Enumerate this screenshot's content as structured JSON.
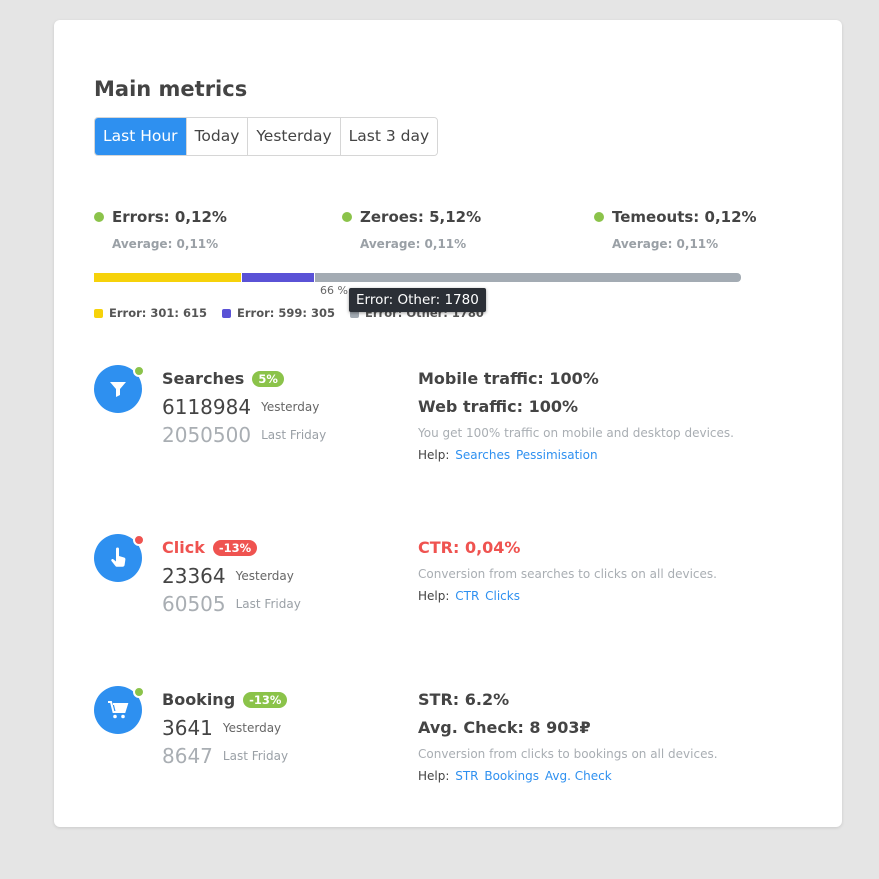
{
  "title": "Main metrics",
  "tabs": [
    "Last Hour",
    "Today",
    "Yesterday",
    "Last 3 day"
  ],
  "active_tab": 0,
  "colors": {
    "accent": "#2e90f0",
    "green": "#8bc34a",
    "red": "#ef5350",
    "yellow": "#f6d20a",
    "purple": "#5a52d6",
    "gray": "#a3abb3"
  },
  "stats": [
    {
      "label": "Errors: 0,12%",
      "avg": "Average: 0,11%"
    },
    {
      "label": "Zeroes: 5,12%",
      "avg": "Average: 0,11%"
    },
    {
      "label": "Temeouts: 0,12%",
      "avg": "Average: 0,11%"
    }
  ],
  "error_bar": {
    "segments": [
      {
        "name": "Error: 301",
        "value": 615,
        "legend": "Error: 301: 615"
      },
      {
        "name": "Error: 599",
        "value": 305,
        "legend": "Error: 599: 305"
      },
      {
        "name": "Error: Other",
        "value": 1780,
        "legend": "Error: Other: 1780"
      }
    ],
    "percent_label": "66 %",
    "tooltip": "Error: Other: 1780"
  },
  "metrics": [
    {
      "name": "Searches",
      "badge": "5%",
      "status": "green",
      "icon": "filter-icon",
      "yesterday_value": "6118984",
      "yesterday_label": "Yesterday",
      "lastweek_value": "2050500",
      "lastweek_label": "Last Friday",
      "lines": [
        "Mobile traffic: 100%",
        "Web traffic: 100%"
      ],
      "desc": "You get 100% traffic on mobile and desktop devices.",
      "help_label": "Help:",
      "help_links": [
        "Searches",
        "Pessimisation"
      ]
    },
    {
      "name": "Click",
      "badge": "-13%",
      "status": "red",
      "icon": "pointer-icon",
      "yesterday_value": "23364",
      "yesterday_label": "Yesterday",
      "lastweek_value": "60505",
      "lastweek_label": "Last Friday",
      "lines": [
        "CTR: 0,04%"
      ],
      "desc": "Conversion from searches to clicks on all devices.",
      "help_label": "Help:",
      "help_links": [
        "CTR",
        "Clicks"
      ]
    },
    {
      "name": "Booking",
      "badge": "-13%",
      "status": "green",
      "icon": "cart-icon",
      "yesterday_value": "3641",
      "yesterday_label": "Yesterday",
      "lastweek_value": "8647",
      "lastweek_label": "Last Friday",
      "lines": [
        "STR: 6.2%",
        "Avg. Check: 8 903₽"
      ],
      "desc": "Conversion from clicks to bookings on all devices.",
      "help_label": "Help:",
      "help_links": [
        "STR",
        "Bookings",
        "Avg. Check"
      ]
    }
  ]
}
